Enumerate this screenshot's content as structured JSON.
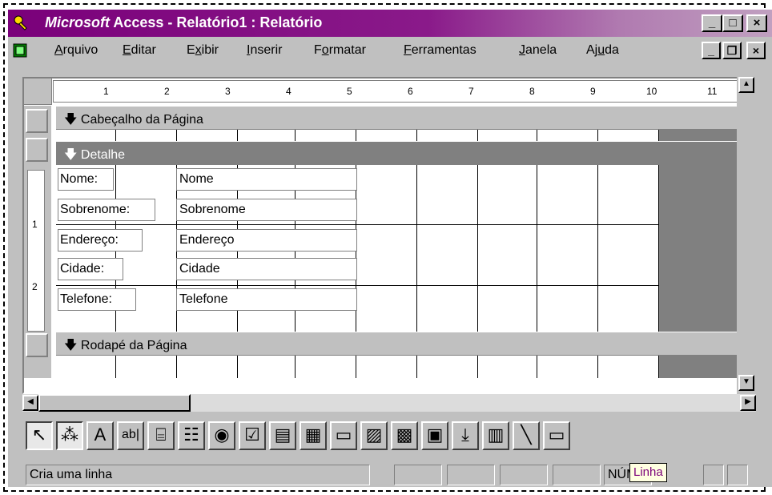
{
  "window": {
    "title_brand": "Microsoft",
    "title_rest": " Access - Relatório1 : Relatório",
    "minimize_glyph": "_",
    "maximize_glyph": "□",
    "close_glyph": "×"
  },
  "menu": {
    "items": [
      {
        "accel": "A",
        "rest": "rquivo"
      },
      {
        "accel": "E",
        "rest": "ditar"
      },
      {
        "pre": "E",
        "accel": "x",
        "rest": "ibir"
      },
      {
        "accel": "I",
        "rest": "nserir"
      },
      {
        "pre": "F",
        "accel": "o",
        "rest": "rmatar"
      },
      {
        "accel": "F",
        "rest": "erramentas"
      },
      {
        "accel": "J",
        "rest": "anela"
      },
      {
        "pre": "Aj",
        "accel": "u",
        "rest": "da"
      }
    ],
    "doc_minimize": "_",
    "doc_restore": "❐",
    "doc_close": "×"
  },
  "ruler": {
    "h_numbers": [
      "1",
      "2",
      "3",
      "4",
      "5",
      "6",
      "7",
      "8",
      "9",
      "10",
      "11"
    ],
    "v_numbers": [
      "1",
      "2"
    ]
  },
  "sections": {
    "page_header": "Cabeçalho da Página",
    "detail": "Detalhe",
    "page_footer": "Rodapé da Página"
  },
  "controls": [
    {
      "label": "Nome:",
      "field": "Nome"
    },
    {
      "label": "Sobrenome:",
      "field": "Sobrenome"
    },
    {
      "label": "Endereço:",
      "field": "Endereço"
    },
    {
      "label": "Cidade:",
      "field": "Cidade"
    },
    {
      "label": "Telefone:",
      "field": "Telefone"
    }
  ],
  "toolbox": {
    "tools": [
      {
        "name": "select-objects-tool",
        "glyph": "↖",
        "pressed": true
      },
      {
        "name": "control-wizards-tool",
        "glyph": "⁂",
        "pressed": true
      },
      {
        "name": "label-tool",
        "glyph": "A",
        "pressed": false
      },
      {
        "name": "text-box-tool",
        "glyph": "ab|",
        "pressed": false
      },
      {
        "name": "option-group-tool",
        "glyph": "⌸",
        "pressed": false
      },
      {
        "name": "toggle-button-tool",
        "glyph": "☷",
        "pressed": false
      },
      {
        "name": "option-button-tool",
        "glyph": "◉",
        "pressed": false
      },
      {
        "name": "check-box-tool",
        "glyph": "☑",
        "pressed": false
      },
      {
        "name": "combo-box-tool",
        "glyph": "▤",
        "pressed": false
      },
      {
        "name": "list-box-tool",
        "glyph": "▦",
        "pressed": false
      },
      {
        "name": "command-button-tool",
        "glyph": "▭",
        "pressed": false
      },
      {
        "name": "image-tool",
        "glyph": "▨",
        "pressed": false
      },
      {
        "name": "unbound-object-frame-tool",
        "glyph": "▩",
        "pressed": false
      },
      {
        "name": "bound-object-frame-tool",
        "glyph": "▣",
        "pressed": false
      },
      {
        "name": "page-break-tool",
        "glyph": "⤓",
        "pressed": false
      },
      {
        "name": "tab-control-tool",
        "glyph": "▥",
        "pressed": false
      },
      {
        "name": "line-tool",
        "glyph": "╲",
        "pressed": false
      },
      {
        "name": "rectangle-tool",
        "glyph": "▭",
        "pressed": false
      }
    ]
  },
  "status": {
    "message": "Cria uma linha",
    "num_indicator": "NÚM"
  },
  "tooltip": {
    "text": "Linha"
  }
}
